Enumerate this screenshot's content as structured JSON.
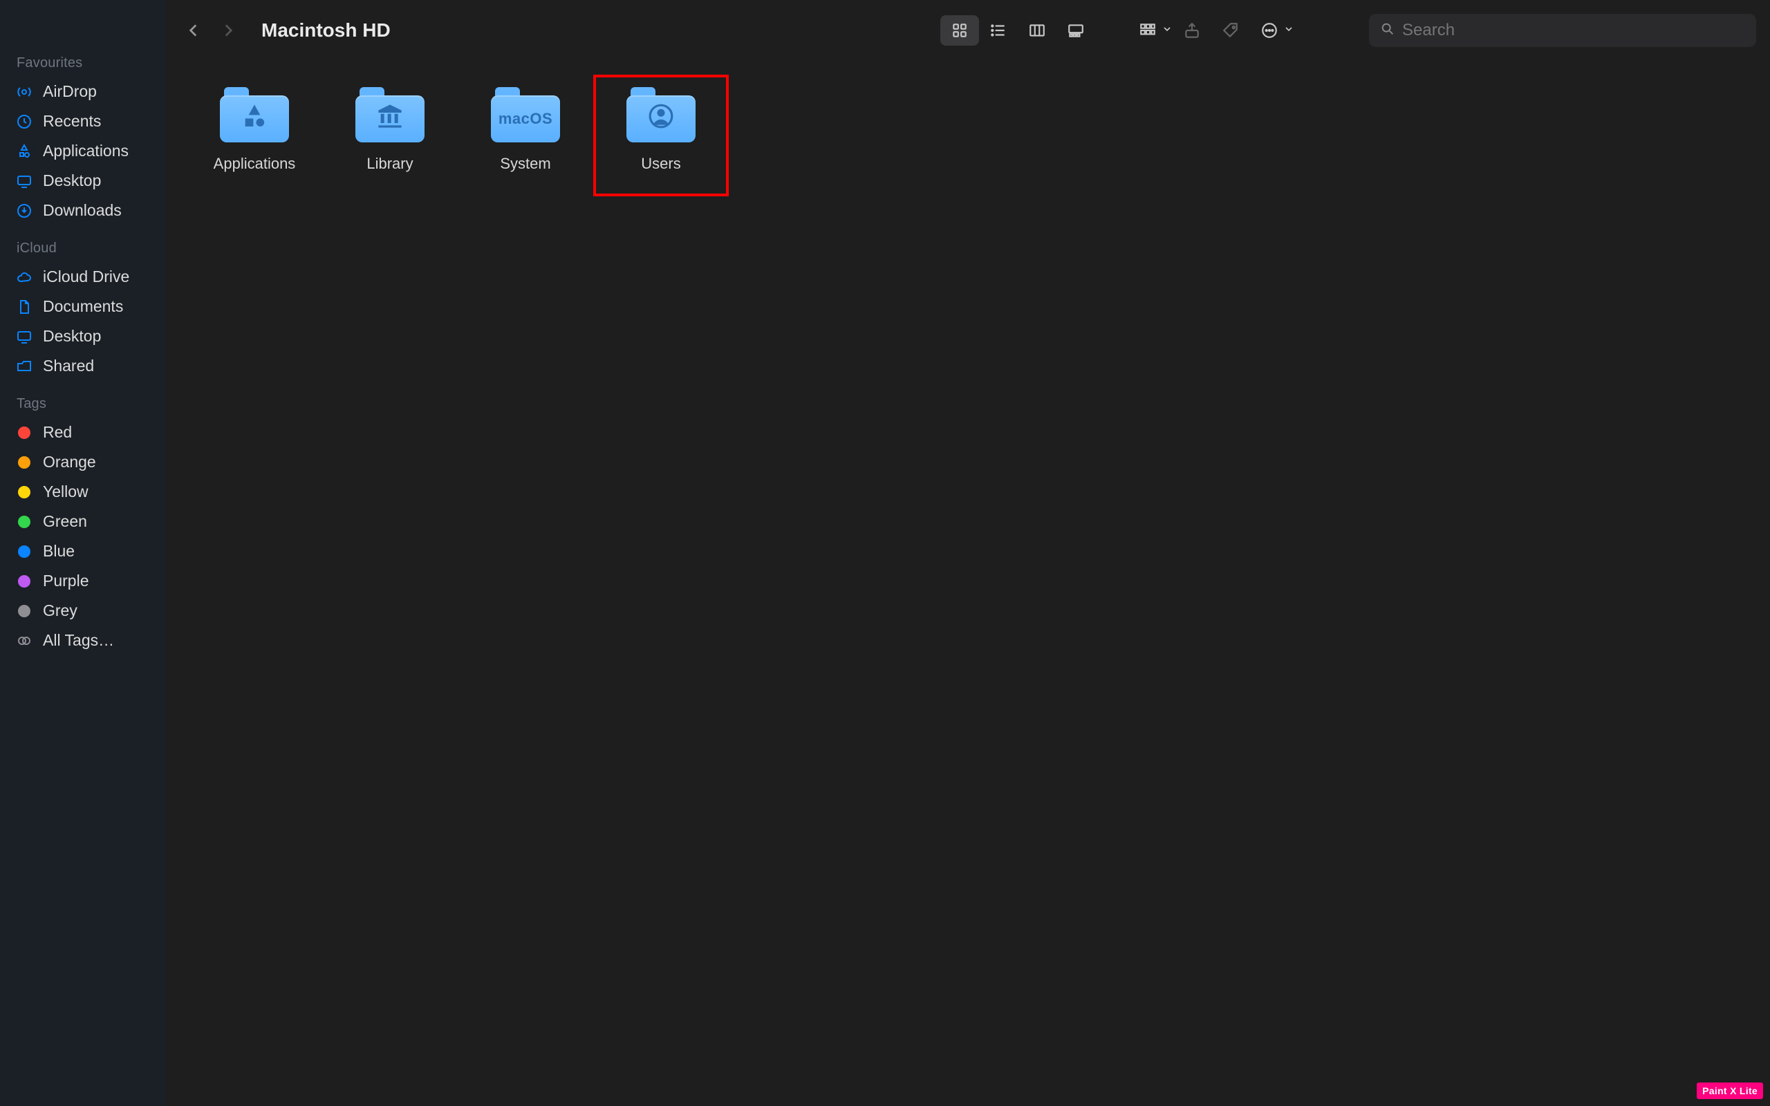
{
  "window": {
    "title": "Macintosh HD"
  },
  "sidebar": {
    "sections": [
      {
        "title": "Favourites",
        "items": [
          {
            "label": "AirDrop",
            "icon": "airdrop"
          },
          {
            "label": "Recents",
            "icon": "clock"
          },
          {
            "label": "Applications",
            "icon": "apps"
          },
          {
            "label": "Desktop",
            "icon": "desktop"
          },
          {
            "label": "Downloads",
            "icon": "download"
          }
        ]
      },
      {
        "title": "iCloud",
        "items": [
          {
            "label": "iCloud Drive",
            "icon": "cloud"
          },
          {
            "label": "Documents",
            "icon": "document"
          },
          {
            "label": "Desktop",
            "icon": "desktop"
          },
          {
            "label": "Shared",
            "icon": "shared"
          }
        ]
      },
      {
        "title": "Tags",
        "items": [
          {
            "label": "Red",
            "icon": "tag",
            "color": "red"
          },
          {
            "label": "Orange",
            "icon": "tag",
            "color": "orange"
          },
          {
            "label": "Yellow",
            "icon": "tag",
            "color": "yellow"
          },
          {
            "label": "Green",
            "icon": "tag",
            "color": "green"
          },
          {
            "label": "Blue",
            "icon": "tag",
            "color": "blue"
          },
          {
            "label": "Purple",
            "icon": "tag",
            "color": "purple"
          },
          {
            "label": "Grey",
            "icon": "tag",
            "color": "grey"
          },
          {
            "label": "All Tags…",
            "icon": "alltags"
          }
        ]
      }
    ]
  },
  "toolbar": {
    "view_mode": "icon",
    "search_placeholder": "Search"
  },
  "folders": [
    {
      "label": "Applications",
      "glyph_icon": "apps-a"
    },
    {
      "label": "Library",
      "glyph_icon": "library"
    },
    {
      "label": "System",
      "glyph_text": "macOS"
    },
    {
      "label": "Users",
      "glyph_icon": "user",
      "highlighted": true
    }
  ],
  "watermark": {
    "text": "Paint X Lite"
  }
}
